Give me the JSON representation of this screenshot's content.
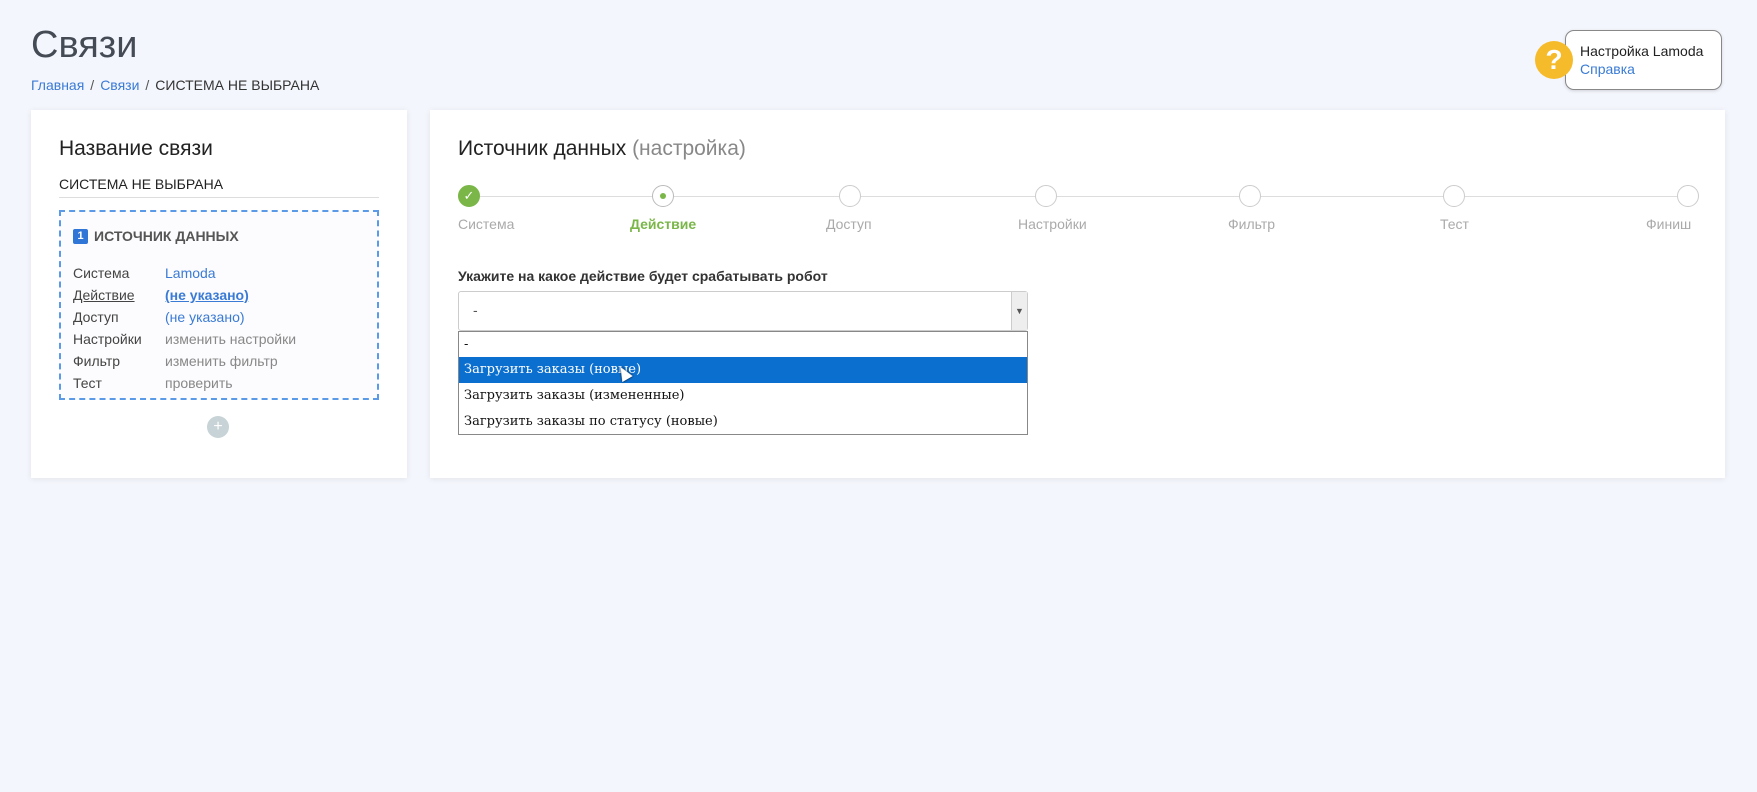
{
  "page": {
    "title": "Связи",
    "breadcrumb": [
      "Главная",
      "Связи",
      "СИСТЕМА НЕ ВЫБРАНА"
    ]
  },
  "help": {
    "icon": "?",
    "title": "Настройка Lamoda",
    "link": "Справка"
  },
  "left": {
    "title": "Название связи",
    "connection_name": "СИСТЕМА НЕ ВЫБРАНА",
    "source": {
      "number": "1",
      "title": "ИСТОЧНИК ДАННЫХ",
      "rows": [
        {
          "key": "Система",
          "value": "Lamoda"
        },
        {
          "key": "Действие",
          "value": "(не указано)"
        },
        {
          "key": "Доступ",
          "value": "(не указано)"
        },
        {
          "key": "Настройки",
          "value": "изменить настройки"
        },
        {
          "key": "Фильтр",
          "value": "изменить фильтр"
        },
        {
          "key": "Тест",
          "value": "проверить"
        }
      ]
    },
    "add_icon": "+"
  },
  "right": {
    "title": "Источник данных",
    "subtitle": "(настройка)",
    "steps": [
      "Система",
      "Действие",
      "Доступ",
      "Настройки",
      "Фильтр",
      "Тест",
      "Финиш"
    ],
    "field_label": "Укажите на какое действие будет срабатывать робот",
    "select_value": "-",
    "options": [
      "-",
      "Загрузить заказы (новые)",
      "Загрузить заказы (измененные)",
      "Загрузить заказы по статусу (новые)"
    ]
  },
  "colors": {
    "accent_green": "#7ab648",
    "link_blue": "#3a7bd5",
    "selected_option": "#0b6fd0",
    "help_yellow": "#f6bb2b"
  }
}
